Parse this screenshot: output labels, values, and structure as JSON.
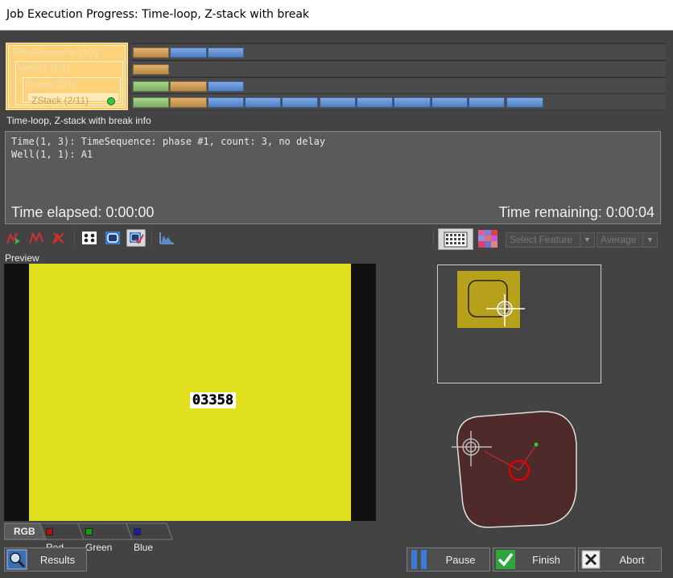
{
  "window": {
    "title": "Job Execution Progress: Time-loop, Z-stack with break"
  },
  "tree": {
    "nodes": [
      "TimeSequence (1/3)",
      "Wells1 (1/1)",
      "Points (2/3)",
      "ZStack (2/11)"
    ]
  },
  "info": {
    "title": "Time-loop, Z-stack with break info",
    "lines": [
      "Time(1, 3): TimeSequence: phase #1, count: 3, no delay",
      "Well(1, 1): A1"
    ],
    "elapsed": "Time elapsed: 0:00:00",
    "remaining": "Time remaining: 0:00:04"
  },
  "toolbar": {
    "feature_placeholder": "Select Feature",
    "average_label": "Average"
  },
  "preview": {
    "label": "Preview",
    "counter": "03358"
  },
  "channels": [
    "RGB",
    "Red",
    "Green",
    "Blue"
  ],
  "channel_colors": [
    "",
    "#b01010",
    "#12a012",
    "#1a1ab0"
  ],
  "buttons": {
    "results": "Results",
    "pause": "Pause",
    "finish": "Finish",
    "abort": "Abort"
  },
  "colors": {
    "accent_orange": "#f8c25a",
    "track_blue": "#5b88cc",
    "track_orange": "#c89a55",
    "track_green": "#94c477",
    "preview_yellow": "#e0e01e",
    "stage_red": "#e00000"
  }
}
